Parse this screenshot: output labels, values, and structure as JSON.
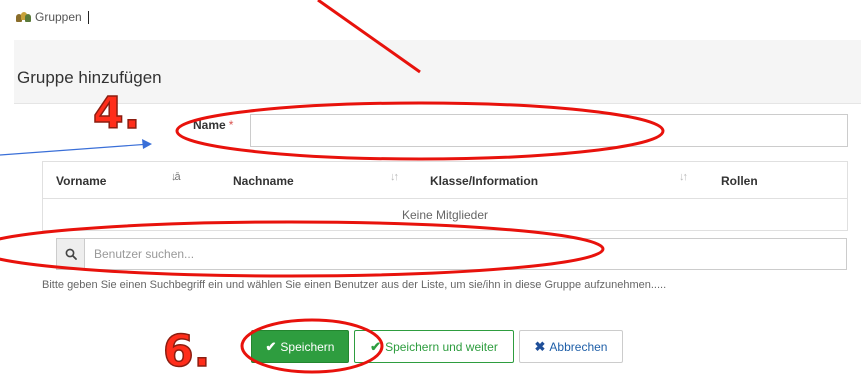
{
  "breadcrumb": {
    "icon": "people-group-icon",
    "label": "Gruppen"
  },
  "page": {
    "title": "Gruppe hinzufügen"
  },
  "form": {
    "name_label": "Name",
    "required_marker": "*",
    "name_value": ""
  },
  "table": {
    "columns": [
      {
        "label": "Vorname",
        "sort": "ascending"
      },
      {
        "label": "Nachname",
        "sort": "none"
      },
      {
        "label": "Klasse/Information",
        "sort": "none"
      },
      {
        "label": "Rollen",
        "sort": null
      }
    ],
    "empty_text": "Keine Mitglieder"
  },
  "search": {
    "placeholder": "Benutzer suchen...",
    "icon": "search-icon",
    "help": "Bitte geben Sie einen Suchbegriff ein und wählen Sie einen Benutzer aus der Liste, um sie/ihn in diese Gruppe aufzunehmen....."
  },
  "buttons": {
    "save": "Speichern",
    "save_next": "Speichern und weiter",
    "cancel": "Abbrechen"
  },
  "annotations": {
    "step4": "4.",
    "step6": "6.",
    "color": "#e8120c"
  },
  "colors": {
    "primary_green": "#2e9d3f",
    "cancel_blue": "#1f5fa8",
    "required_red": "#d9534f"
  }
}
